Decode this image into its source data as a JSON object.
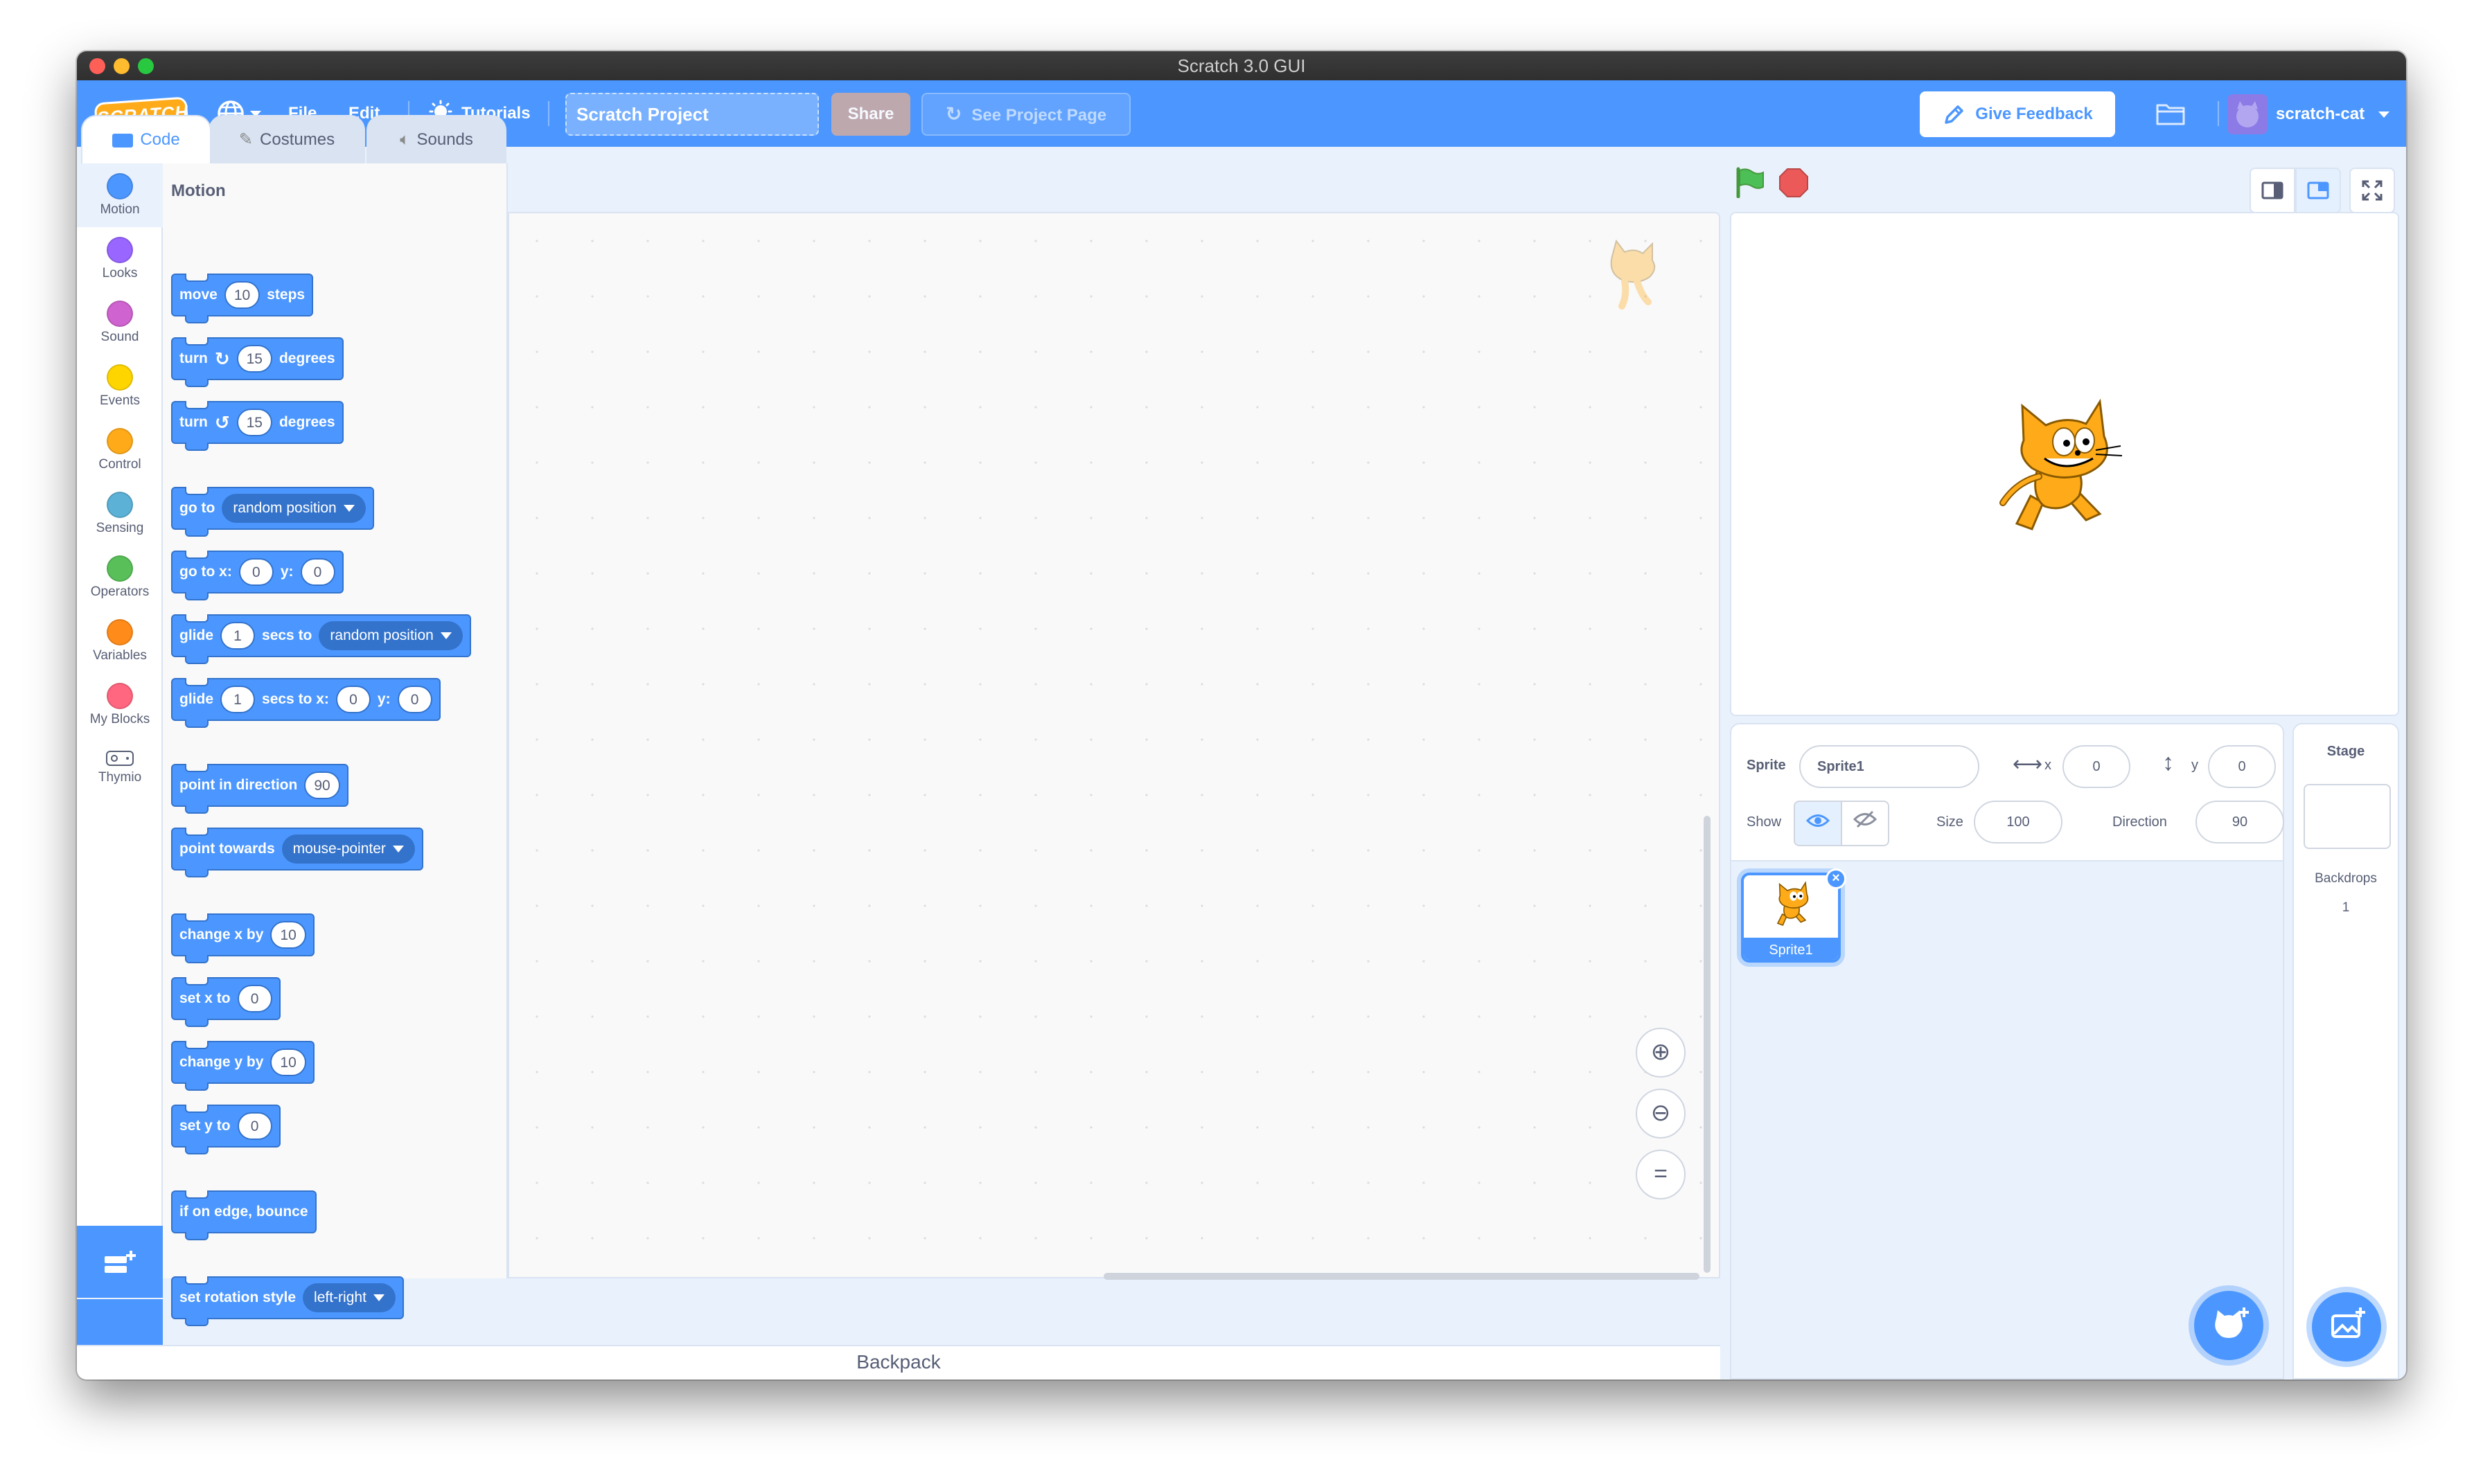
{
  "window": {
    "title": "Scratch 3.0 GUI"
  },
  "menubar": {
    "logo_text": "SCRATCH",
    "file": "File",
    "edit": "Edit",
    "tutorials": "Tutorials",
    "project_title": "Scratch Project",
    "share": "Share",
    "see_project_page": "See Project Page",
    "give_feedback": "Give Feedback",
    "username": "scratch-cat"
  },
  "tabs": {
    "code": "Code",
    "costumes": "Costumes",
    "sounds": "Sounds"
  },
  "categories": [
    {
      "label": "Motion",
      "color": "#4c97ff"
    },
    {
      "label": "Looks",
      "color": "#9966ff"
    },
    {
      "label": "Sound",
      "color": "#cf63cf"
    },
    {
      "label": "Events",
      "color": "#ffd500"
    },
    {
      "label": "Control",
      "color": "#ffab19"
    },
    {
      "label": "Sensing",
      "color": "#5cb1d6"
    },
    {
      "label": "Operators",
      "color": "#59c059"
    },
    {
      "label": "Variables",
      "color": "#ff8c1a"
    },
    {
      "label": "My Blocks",
      "color": "#ff6680"
    },
    {
      "label": "Thymio",
      "color": "#ffffff"
    }
  ],
  "palette": {
    "heading": "Motion",
    "blocks": {
      "move": {
        "a": "move",
        "v": "10",
        "b": "steps"
      },
      "turn_right": {
        "a": "turn",
        "v": "15",
        "b": "degrees"
      },
      "turn_left": {
        "a": "turn",
        "v": "15",
        "b": "degrees"
      },
      "goto": {
        "a": "go to",
        "d": "random position"
      },
      "goto_xy": {
        "a": "go to x:",
        "x": "0",
        "b": "y:",
        "y": "0"
      },
      "glide_to": {
        "a": "glide",
        "v": "1",
        "b": "secs to",
        "d": "random position"
      },
      "glide_xy": {
        "a": "glide",
        "v": "1",
        "b": "secs to x:",
        "x": "0",
        "c": "y:",
        "y": "0"
      },
      "point_dir": {
        "a": "point in direction",
        "v": "90"
      },
      "point_towards": {
        "a": "point towards",
        "d": "mouse-pointer"
      },
      "change_x": {
        "a": "change x by",
        "v": "10"
      },
      "set_x": {
        "a": "set x to",
        "v": "0"
      },
      "change_y": {
        "a": "change y by",
        "v": "10"
      },
      "set_y": {
        "a": "set y to",
        "v": "0"
      },
      "bounce": {
        "a": "if on edge, bounce"
      },
      "rotation": {
        "a": "set rotation style",
        "d": "left-right"
      }
    }
  },
  "backpack": "Backpack",
  "sprite_info": {
    "sprite_label": "Sprite",
    "sprite_name": "Sprite1",
    "x_label": "x",
    "x_value": "0",
    "y_label": "y",
    "y_value": "0",
    "show_label": "Show",
    "size_label": "Size",
    "size_value": "100",
    "direction_label": "Direction",
    "direction_value": "90"
  },
  "sprites": [
    {
      "name": "Sprite1"
    }
  ],
  "stage_panel": {
    "title": "Stage",
    "backdrops_label": "Backdrops",
    "backdrops_count": "1"
  }
}
